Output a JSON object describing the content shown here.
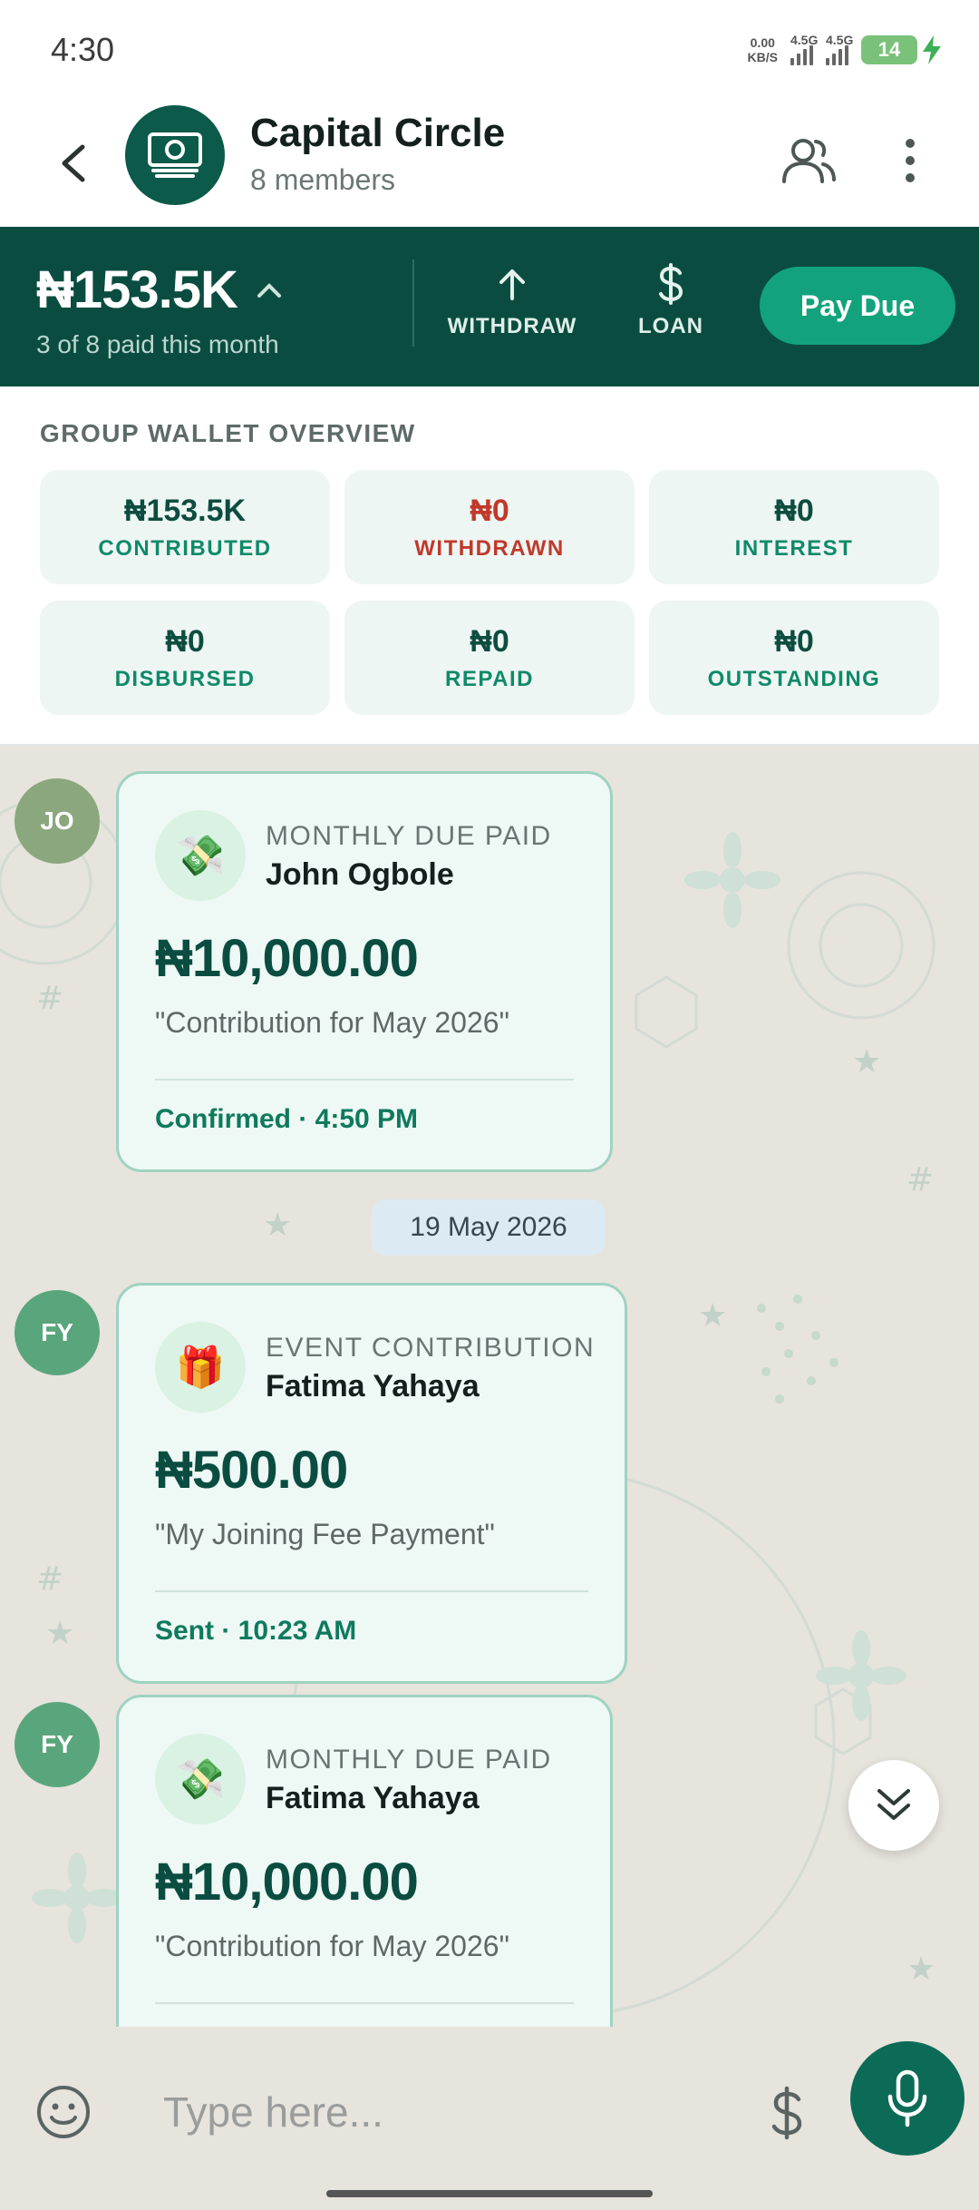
{
  "status_bar": {
    "time": "4:30",
    "net_speed_value": "0.00",
    "net_speed_unit": "KB/S",
    "signal_1": "4.5G",
    "signal_2": "4.5G",
    "battery": "14"
  },
  "header": {
    "title": "Capital Circle",
    "subtitle": "8 members",
    "icons": [
      "back-arrow-icon",
      "money-icon",
      "members-icon",
      "more-icon"
    ]
  },
  "summary": {
    "balance": "₦153.5K",
    "paid_count": "3 of 8 paid this month",
    "withdraw_label": "WITHDRAW",
    "loan_label": "LOAN",
    "pay_due_label": "Pay Due"
  },
  "wallet": {
    "title": "GROUP WALLET OVERVIEW",
    "stats": [
      {
        "value": "₦153.5K",
        "label": "CONTRIBUTED"
      },
      {
        "value": "₦0",
        "label": "WITHDRAWN"
      },
      {
        "value": "₦0",
        "label": "INTEREST"
      },
      {
        "value": "₦0",
        "label": "DISBURSED"
      },
      {
        "value": "₦0",
        "label": "REPAID"
      },
      {
        "value": "₦0",
        "label": "OUTSTANDING"
      }
    ],
    "colors": {
      "positive": "#0f8a69",
      "negative": "#c0392b"
    }
  },
  "messages": [
    {
      "initials": "JO",
      "avatar_color": "#8aa77d",
      "type": "MONTHLY DUE PAID",
      "name": "John Ogbole",
      "amount": "₦10,000.00",
      "note": "\"Contribution for May 2026\"",
      "status": "Confirmed · 4:50 PM",
      "icon": "money-emoji-icon"
    },
    {
      "initials": "FY",
      "avatar_color": "#5aa67c",
      "type": "EVENT CONTRIBUTION",
      "name": "Fatima Yahaya",
      "amount": "₦500.00",
      "note": "\"My Joining Fee Payment\"",
      "status": "Sent · 10:23 AM",
      "icon": "gift-emoji-icon"
    },
    {
      "initials": "FY",
      "avatar_color": "#5aa67c",
      "type": "MONTHLY DUE PAID",
      "name": "Fatima Yahaya",
      "amount": "₦10,000.00",
      "note": "\"Contribution for May 2026\"",
      "icon": "money-emoji-icon"
    }
  ],
  "date_separator": "19 May 2026",
  "composer": {
    "placeholder": "Type here..."
  },
  "theme": {
    "primary_dark": "#0a4d40",
    "accent": "#12a37c",
    "chat_bg": "#e7e3dd"
  }
}
